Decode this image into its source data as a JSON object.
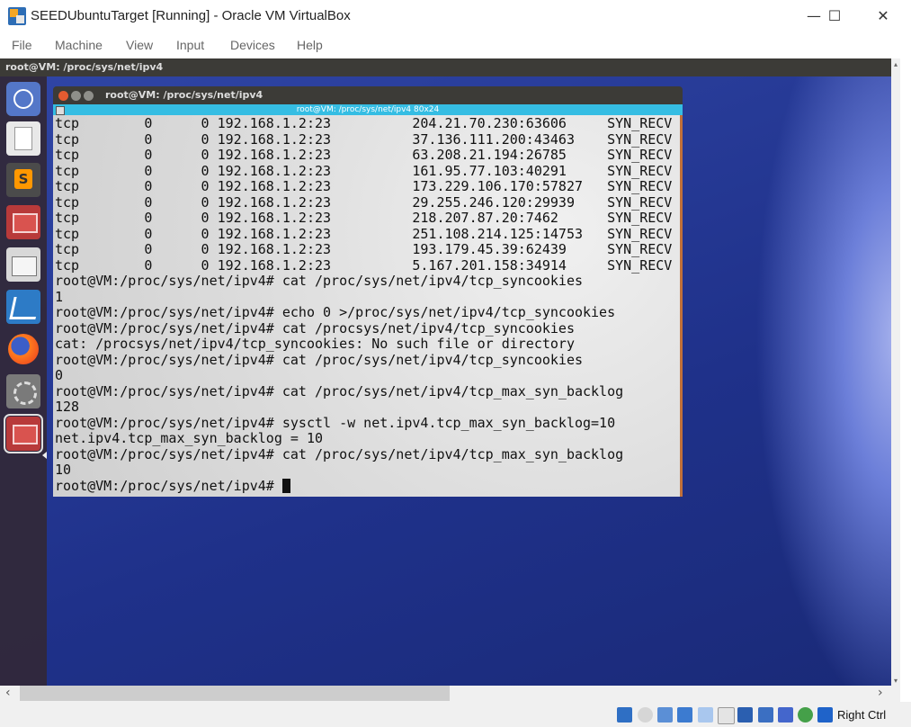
{
  "host": {
    "title": "SEEDUbuntuTarget [Running] - Oracle VM VirtualBox",
    "buttons": {
      "minimize": "—",
      "maximize": "☐",
      "close": "✕"
    },
    "menu": [
      "File",
      "Machine",
      "View",
      "Input",
      "Devices",
      "Help"
    ],
    "status_key": "Right Ctrl"
  },
  "guest": {
    "top_title": "root@VM: /proc/sys/net/ipv4",
    "launcher": [
      "ubuntu-dash",
      "text-editor",
      "sublime-text",
      "terminal",
      "files",
      "wireshark",
      "firefox",
      "system-settings",
      "terminal-active"
    ]
  },
  "terminal": {
    "title": "root@VM: /proc/sys/net/ipv4",
    "inner_title": "root@VM: /proc/sys/net/ipv4 80x24",
    "lines": [
      "tcp        0      0 192.168.1.2:23          204.21.70.230:63606     SYN_RECV",
      "tcp        0      0 192.168.1.2:23          37.136.111.200:43463    SYN_RECV",
      "tcp        0      0 192.168.1.2:23          63.208.21.194:26785     SYN_RECV",
      "tcp        0      0 192.168.1.2:23          161.95.77.103:40291     SYN_RECV",
      "tcp        0      0 192.168.1.2:23          173.229.106.170:57827   SYN_RECV",
      "tcp        0      0 192.168.1.2:23          29.255.246.120:29939    SYN_RECV",
      "tcp        0      0 192.168.1.2:23          218.207.87.20:7462      SYN_RECV",
      "tcp        0      0 192.168.1.2:23          251.108.214.125:14753   SYN_RECV",
      "tcp        0      0 192.168.1.2:23          193.179.45.39:62439     SYN_RECV",
      "tcp        0      0 192.168.1.2:23          5.167.201.158:34914     SYN_RECV",
      "root@VM:/proc/sys/net/ipv4# cat /proc/sys/net/ipv4/tcp_syncookies",
      "1",
      "root@VM:/proc/sys/net/ipv4# echo 0 >/proc/sys/net/ipv4/tcp_syncookies",
      "root@VM:/proc/sys/net/ipv4# cat /procsys/net/ipv4/tcp_syncookies",
      "cat: /procsys/net/ipv4/tcp_syncookies: No such file or directory",
      "root@VM:/proc/sys/net/ipv4# cat /proc/sys/net/ipv4/tcp_syncookies",
      "0",
      "root@VM:/proc/sys/net/ipv4# cat /proc/sys/net/ipv4/tcp_max_syn_backlog",
      "128",
      "root@VM:/proc/sys/net/ipv4# sysctl -w net.ipv4.tcp_max_syn_backlog=10",
      "net.ipv4.tcp_max_syn_backlog = 10",
      "root@VM:/proc/sys/net/ipv4# cat /proc/sys/net/ipv4/tcp_max_syn_backlog",
      "10"
    ],
    "prompt": "root@VM:/proc/sys/net/ipv4# "
  }
}
